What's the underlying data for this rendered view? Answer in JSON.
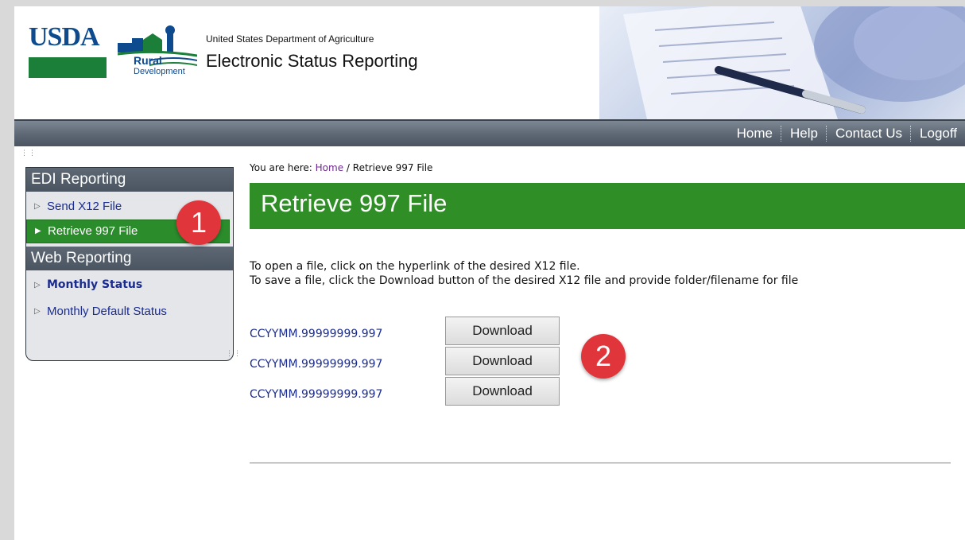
{
  "header": {
    "logo_text": "USDA",
    "logo_sub1": "Rural",
    "logo_sub2": "Development",
    "department": "United States Department of Agriculture",
    "app_title": "Electronic Status Reporting"
  },
  "nav": {
    "links": [
      "Home",
      "Help",
      "Contact Us",
      "Logoff"
    ]
  },
  "sidebar": {
    "sections": [
      {
        "heading": "EDI Reporting",
        "items": [
          {
            "label": "Send X12 File",
            "active": false
          },
          {
            "label": "Retrieve 997 File",
            "active": true
          }
        ]
      },
      {
        "heading": "Web Reporting",
        "items": [
          {
            "label": "Monthly Status",
            "active": false
          },
          {
            "label": "Monthly Default Status",
            "active": false
          }
        ]
      }
    ]
  },
  "breadcrumb": {
    "prefix": "You are here:",
    "home": "Home",
    "separator": "/",
    "current": "Retrieve 997 File"
  },
  "page_title": "Retrieve 997 File",
  "instructions": {
    "line1": "To open a file, click on the hyperlink of the desired X12 file.",
    "line2": "To save a file, click the Download button of the desired X12 file and provide folder/filename for file"
  },
  "files": [
    {
      "name": "CCYYMM.99999999.997",
      "button": "Download"
    },
    {
      "name": "CCYYMM.99999999.997",
      "button": "Download"
    },
    {
      "name": "CCYYMM.99999999.997",
      "button": "Download"
    }
  ],
  "annotations": {
    "badge1": "1",
    "badge2": "2"
  },
  "colors": {
    "title_bar": "#2f8f26",
    "nav_bar": "#5c6773",
    "link": "#1b2c8f",
    "badge": "#e0353b"
  }
}
